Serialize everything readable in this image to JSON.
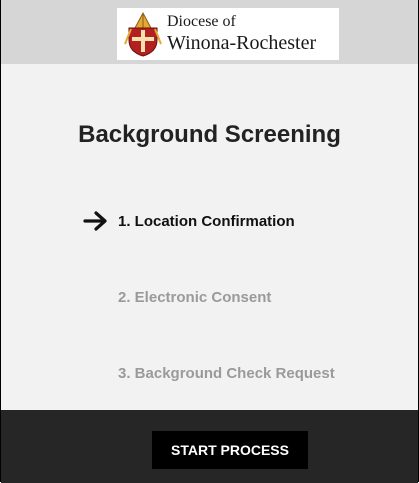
{
  "header": {
    "logo_line1": "Diocese of",
    "logo_line2": "Winona-Rochester",
    "logo_icon": "diocese-coat-of-arms"
  },
  "main": {
    "title": "Background Screening",
    "current_step_indicator_icon": "arrow-right-icon",
    "steps": [
      {
        "label": "1. Location Confirmation",
        "state": "active"
      },
      {
        "label": "2. Electronic Consent",
        "state": "inactive"
      },
      {
        "label": "3. Background Check Request",
        "state": "inactive"
      }
    ]
  },
  "footer": {
    "start_label": "START PROCESS"
  },
  "colors": {
    "header_bg": "#d6d6d6",
    "page_bg": "#f2f2f2",
    "footer_bg": "#262626",
    "button_bg": "#000000",
    "active_step": "#111111",
    "inactive_step": "#9a9a9a"
  }
}
